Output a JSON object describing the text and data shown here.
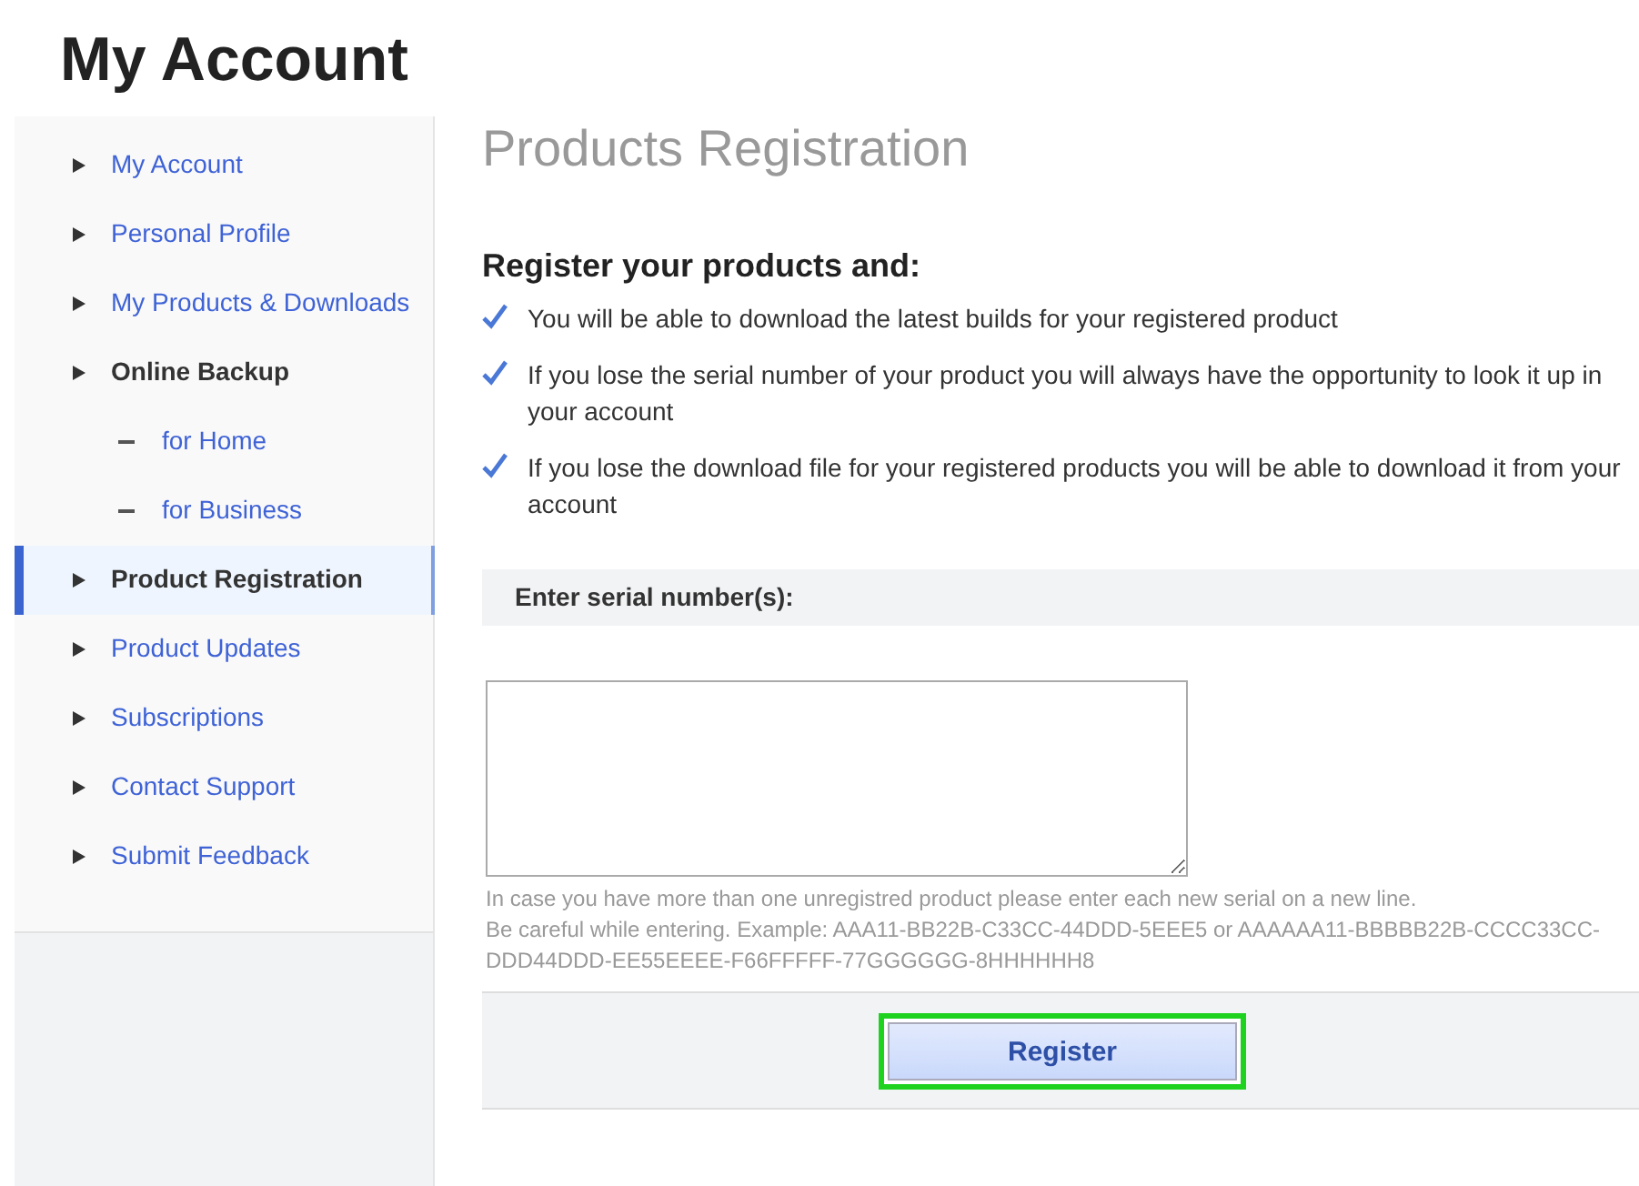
{
  "page_title": "My Account",
  "sidebar": {
    "items": [
      {
        "label": "My Account",
        "kind": "link",
        "selected": false
      },
      {
        "label": "Personal Profile",
        "kind": "link",
        "selected": false
      },
      {
        "label": "My Products & Downloads",
        "kind": "link",
        "selected": false
      },
      {
        "label": "Online Backup",
        "kind": "section",
        "selected": false
      },
      {
        "label": "for Home",
        "kind": "sub",
        "selected": false
      },
      {
        "label": "for Business",
        "kind": "sub",
        "selected": false
      },
      {
        "label": "Product Registration",
        "kind": "section",
        "selected": true
      },
      {
        "label": "Product Updates",
        "kind": "link",
        "selected": false
      },
      {
        "label": "Subscriptions",
        "kind": "link",
        "selected": false
      },
      {
        "label": "Contact Support",
        "kind": "link",
        "selected": false
      },
      {
        "label": "Submit Feedback",
        "kind": "link",
        "selected": false
      }
    ]
  },
  "content": {
    "title": "Products Registration",
    "subtitle": "Register your products and:",
    "benefits": [
      "You will be able to download the latest builds for your registered product",
      "If you lose the serial number of your product you will always have the opportunity to look it up in your account",
      "If you lose the download file for your registered products you will be able to download it from your account"
    ],
    "serial_label": "Enter serial number(s):",
    "hint_lines": [
      "In case you have more than one unregistred product please enter each new serial on a new line.",
      "Be careful while entering. Example: AAA11-BB22B-C33CC-44DDD-5EEE5 or AAAAAA11-BBBBB22B-CCCC33CC-DDD44DDD-EE55EEEE-F66FFFFF-77GGGGGG-8HHHHHH8"
    ],
    "register_button": {
      "label": "Register",
      "focused": true
    }
  }
}
